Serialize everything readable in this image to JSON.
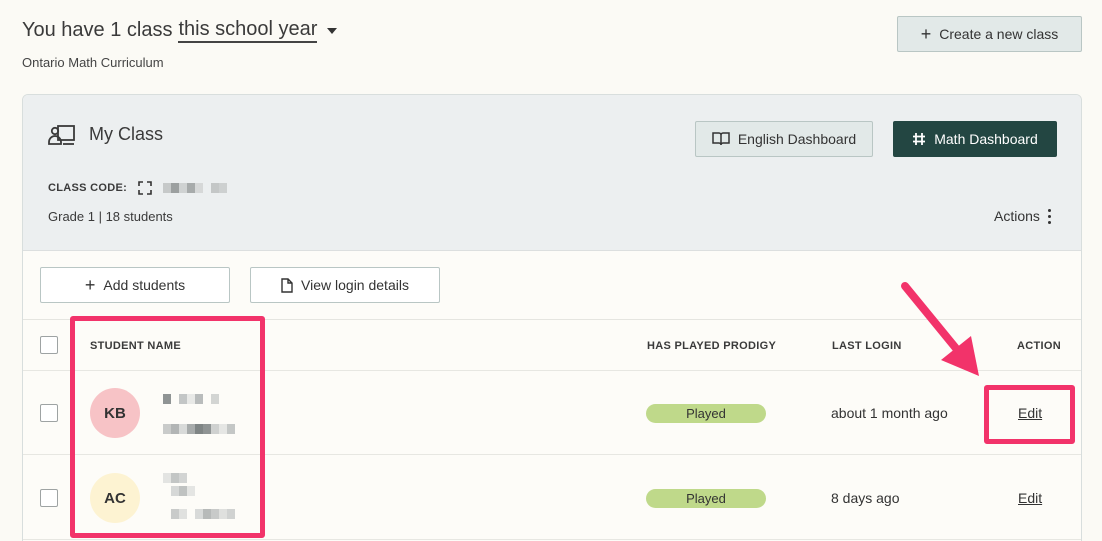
{
  "header": {
    "title_prefix": "You have 1 class",
    "title_period": "this school year",
    "subtitle": "Ontario Math Curriculum",
    "create_button": "Create a new class"
  },
  "class_card": {
    "name": "My Class",
    "english_dashboard": "English Dashboard",
    "math_dashboard": "Math Dashboard",
    "class_code_label": "CLASS CODE:",
    "grade_info": "Grade 1 | 18 students",
    "actions_label": "Actions",
    "add_students": "Add students",
    "view_login_details": "View login details"
  },
  "table": {
    "columns": [
      "STUDENT NAME",
      "HAS PLAYED PRODIGY",
      "LAST LOGIN",
      "ACTION"
    ],
    "rows": [
      {
        "initials": "KB",
        "avatar_color": "#f7c3c6",
        "played": "Played",
        "last_login": "about 1 month ago",
        "action": "Edit"
      },
      {
        "initials": "AC",
        "avatar_color": "#fdf3d2",
        "played": "Played",
        "last_login": "8 days ago",
        "action": "Edit"
      }
    ]
  },
  "colors": {
    "accent_dark": "#234642",
    "played_badge": "#bfd98a",
    "highlight": "#f2336a"
  }
}
